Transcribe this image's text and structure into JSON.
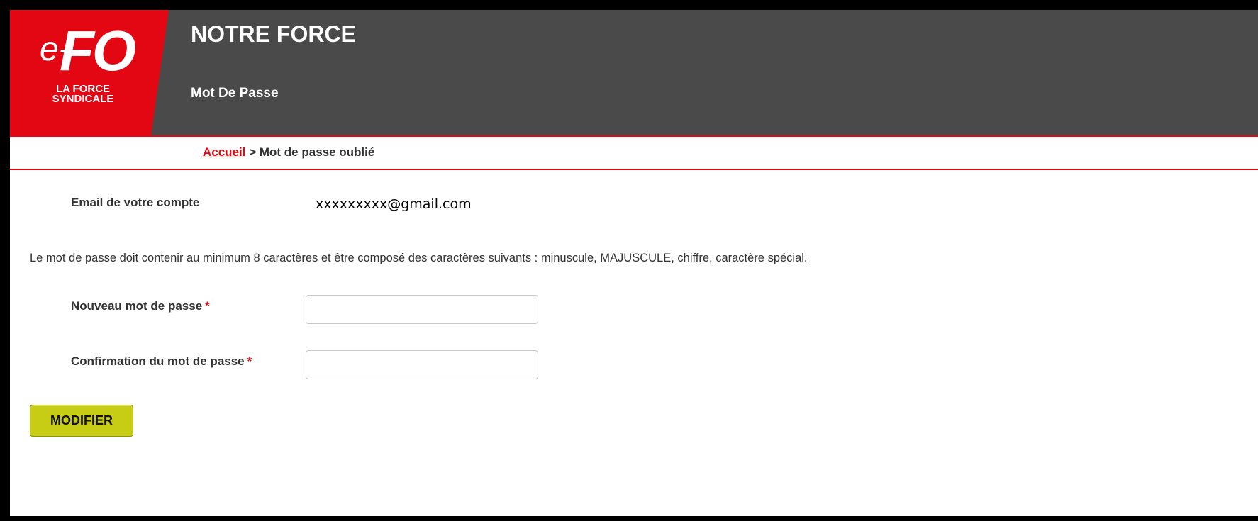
{
  "brand": {
    "logo_e": "e-",
    "logo_fo": "FO",
    "logo_tagline": "LA FORCE SYNDICALE",
    "logo_color": "#e30613"
  },
  "header": {
    "site_title": "NOTRE FORCE",
    "page_subtitle": "Mot De Passe",
    "background": "#4a4a4a"
  },
  "breadcrumb": {
    "home_label": "Accueil",
    "separator": " > ",
    "current": "Mot de passe oublié"
  },
  "form": {
    "email_label": "Email de votre compte",
    "email_value": "xxxxxxxxx@gmail.com",
    "password_rules": "Le mot de passe doit contenir au minimum 8 caractères et être composé des caractères suivants : minuscule, MAJUSCULE, chiffre, caractère spécial.",
    "new_password_label": "Nouveau mot de passe",
    "new_password_value": "",
    "confirm_password_label": "Confirmation du mot de passe",
    "confirm_password_value": "",
    "required_marker": "*",
    "submit_label": "MODIFIER",
    "submit_color": "#c7cc14"
  }
}
